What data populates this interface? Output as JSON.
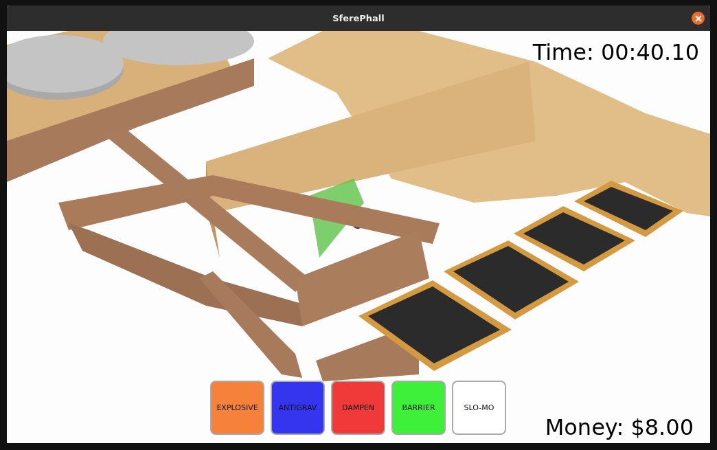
{
  "window": {
    "title": "SferePhall"
  },
  "hud": {
    "time": "Time: 00:40.10",
    "money": "Money: $8.00"
  },
  "powerups": [
    {
      "label": "EXPLOSIVE",
      "color": "#f5813a"
    },
    {
      "label": "ANTIGRAV",
      "color": "#3535f0"
    },
    {
      "label": "DAMPEN",
      "color": "#f03a3a"
    },
    {
      "label": "BARRIER",
      "color": "#3ef03a"
    },
    {
      "label": "SLO-MO",
      "color": "#ffffff"
    }
  ]
}
